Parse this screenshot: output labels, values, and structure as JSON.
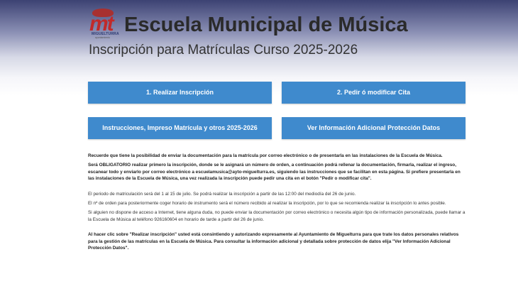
{
  "header": {
    "logo": {
      "mark": "mt",
      "town": "MIGUELTURRA",
      "subtext": "ayuntamiento"
    },
    "title": "Escuela Municipal de Música",
    "subtitle": "Inscripción para Matrículas Curso 2025-2026"
  },
  "buttons": {
    "inscripcion": "1. Realizar Inscripción",
    "cita": "2. Pedir ó modificar Cita",
    "instrucciones": "Instrucciones, Impreso Matrícula y otros 2025-2026",
    "proteccion": "Ver Información Adicional Protección Datos"
  },
  "info": {
    "p1": "Recuerde que tiene la posibilidad de enviar la documentación para la matrícula por correo electrónico o de presentarla en las instalaciones de la Escuela de Música.",
    "p2": "Será OBLIGATORIO realizar primero la inscripción, donde se le asignará un número de orden, a continuación podrá rellenar la documentación, firmarla, realizar el ingreso, escanear todo y enviarlo por correo electrónico a escuelamusica@ayto-miguelturra.es, siguiendo las instrucciones que se facilitan en esta página. Si prefiere presentarla en las instalaciones de la Escuela de Música, una vez realizada la inscripción puede pedir una cita en el botón \"Pedir o modificar cita\".",
    "p3": "El periodo de matriculación será del 1 al 15 de julio. Se podrá realizar la inscripción a partir de las 12:00 del mediodía del 26 de junio.",
    "p4": "El nº de orden para posteriormente coger horario de instrumento será el número recibido al realizar la inscripción, por lo que se recomienda realizar la inscripción lo antes posible.",
    "p5": "Si alguien no dispone de acceso a Internet, tiene alguna duda, no puede enviar la documentación por correo electrónico o necesita algún tipo de información personalizada, puede llamar a la Escuela de Música al teléfono 926160604 en horario de tarde a partir del 26 de junio.",
    "p6": "Al hacer clic sobre \"Realizar inscripción\" usted está consintiendo y autorizando expresamente al Ayuntamiento de Miguelturra para que trate los datos personales relativos para la gestión de las matrículas en la Escuela de Música. Para consultar la información adicional y detallada sobre protección de datos elija \"Ver Información Adicional Protección Datos\"."
  }
}
